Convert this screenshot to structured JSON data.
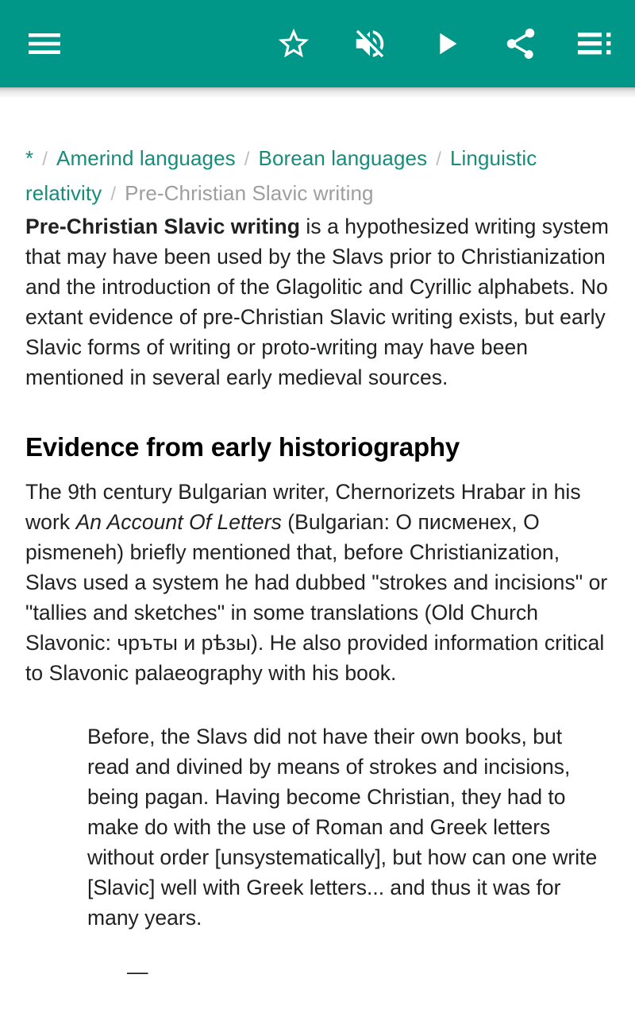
{
  "theme": {
    "appbar_bg": "#009688",
    "link_color": "#178c7b",
    "muted_color": "#9e9e9e",
    "text_color": "#202122"
  },
  "appbar": {
    "icons": [
      {
        "name": "menu-icon",
        "label": "Menu"
      },
      {
        "name": "star-icon",
        "label": "Add to watchlist"
      },
      {
        "name": "volume-off-icon",
        "label": "Mute"
      },
      {
        "name": "play-icon",
        "label": "Play"
      },
      {
        "name": "share-icon",
        "label": "Share"
      },
      {
        "name": "table-of-contents-icon",
        "label": "Contents"
      }
    ]
  },
  "breadcrumb": {
    "separator": "/",
    "items": [
      {
        "label": "*",
        "current": false
      },
      {
        "label": "Amerind languages",
        "current": false
      },
      {
        "label": "Borean languages",
        "current": false
      },
      {
        "label": "Linguistic relativity",
        "current": false
      },
      {
        "label": "Pre-Christian Slavic writing",
        "current": true
      }
    ]
  },
  "article": {
    "lead": {
      "title_bold": "Pre-Christian Slavic writing",
      "rest": " is a hypothesized writing system that may have been used by the Slavs prior to Christianization and the introduction of the Glagolitic and Cyrillic alphabets. No extant evidence of pre-Christian Slavic writing exists, but early Slavic forms of writing or proto-writing may have been mentioned in several early medieval sources."
    },
    "section": {
      "heading": "Evidence from early historiography",
      "paragraph_part1": "The 9th century Bulgarian writer, Chernorizets Hrabar in his work ",
      "paragraph_italic": "An Account Of Letters",
      "paragraph_part2": " (Bulgarian: О писменех, О pismeneh) briefly mentioned that, before Christianization, Slavs used a system he had dubbed \"strokes and incisions\" or \"tallies and sketches\" in some translations (Old Church Slavonic: чръты и рѣзы). He also provided information critical to Slavonic palaeography with his book."
    },
    "blockquote": {
      "text": "Before, the Slavs did not have their own books, but read and divined by means of strokes and incisions, being pagan. Having become Christian, they had to make do with the use of Roman and Greek letters without order [unsystematically], but how can one write [Slavic] well with Greek letters... and thus it was for many years.",
      "attribution": "—"
    }
  }
}
